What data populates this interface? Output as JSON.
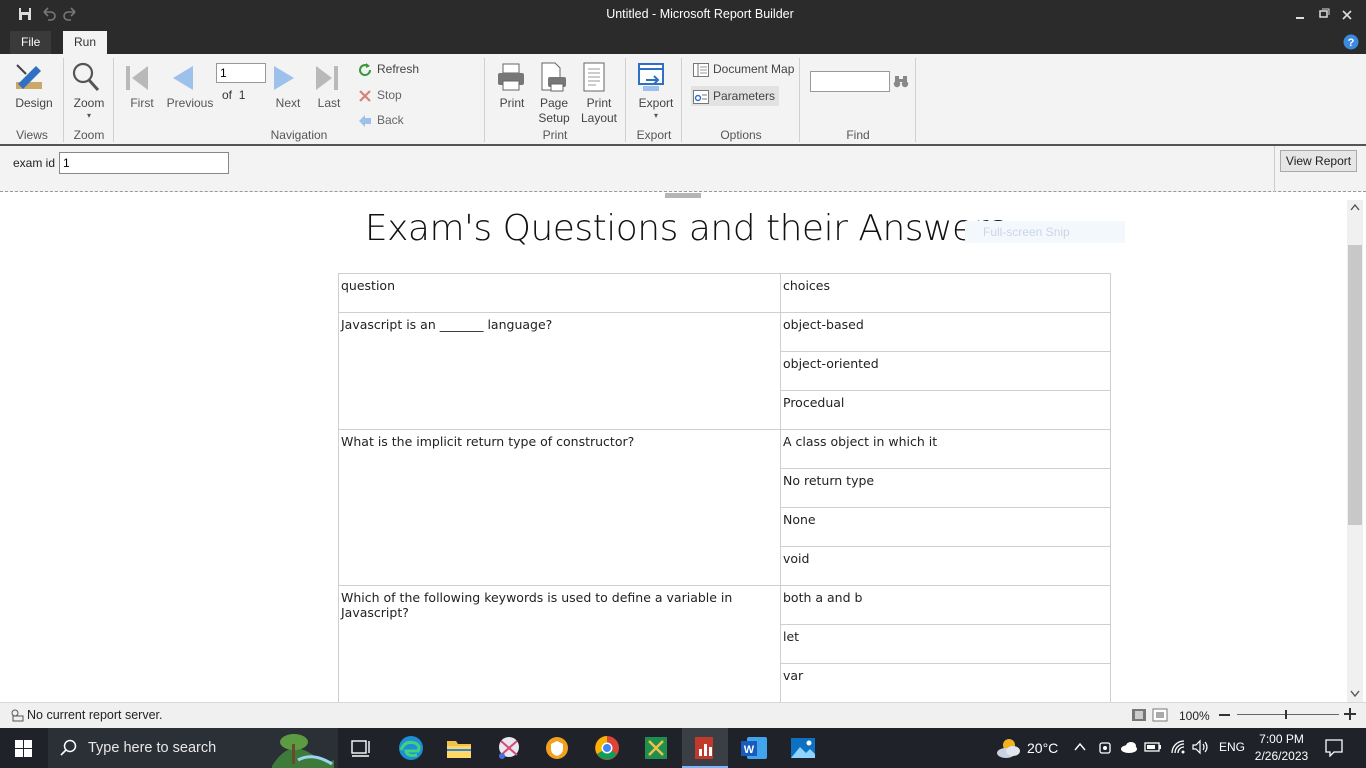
{
  "window": {
    "title": "Untitled - Microsoft Report Builder"
  },
  "tabs": [
    {
      "label": "File"
    },
    {
      "label": "Run"
    }
  ],
  "ribbon": {
    "views": {
      "design": "Design",
      "group": "Views"
    },
    "zoom": {
      "zoom": "Zoom",
      "group": "Zoom"
    },
    "navigation": {
      "first": "First",
      "previous": "Previous",
      "page_value": "1",
      "of_label": "of",
      "total_pages": "1",
      "next": "Next",
      "last": "Last",
      "refresh": "Refresh",
      "stop": "Stop",
      "back": "Back",
      "group": "Navigation"
    },
    "print": {
      "print": "Print",
      "page_setup_1": "Page",
      "page_setup_2": "Setup",
      "print_layout_1": "Print",
      "print_layout_2": "Layout",
      "group": "Print"
    },
    "export": {
      "export": "Export",
      "group": "Export"
    },
    "options": {
      "document_map": "Document Map",
      "parameters": "Parameters",
      "group": "Options"
    },
    "find": {
      "value": "",
      "group": "Find"
    }
  },
  "params": {
    "exam_id_label": "exam id",
    "exam_id_value": "1",
    "view_report": "View Report"
  },
  "report": {
    "title": "Exam's Questions and their Answers",
    "snip_overlay": "Full-screen Snip",
    "header": {
      "question": "question",
      "choices": "choices"
    },
    "rows": [
      {
        "question": "Javascript is an _______ language?",
        "choices": [
          "object-based",
          "object-oriented",
          "Procedual"
        ]
      },
      {
        "question": "What is the implicit return type of constructor?",
        "choices": [
          "A class object in which it",
          "No return type",
          "None",
          "void"
        ]
      },
      {
        "question": "Which of the following keywords is used to define a variable in Javascript?",
        "choices": [
          "both a and b",
          "let",
          "var"
        ]
      }
    ]
  },
  "status": {
    "text": "No current report server.",
    "zoom": "100%"
  },
  "taskbar": {
    "search_placeholder": "Type here to search",
    "weather": "20°C",
    "lang": "ENG",
    "time": "7:00 PM",
    "date": "2/26/2023"
  },
  "colors": {
    "titlebar": "#2b2b2b",
    "ribbon": "#f3f3f3",
    "accent_blue": "#2f6fc4",
    "taskbar": "#1f2228"
  }
}
